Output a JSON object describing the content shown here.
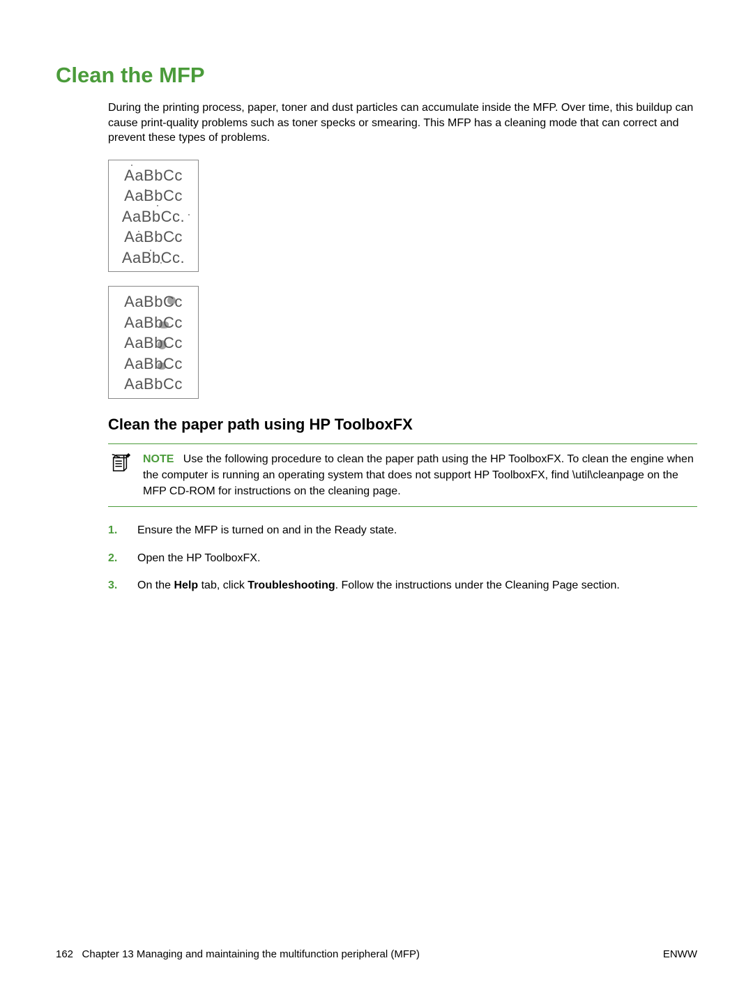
{
  "heading": "Clean the MFP",
  "intro": "During the printing process, paper, toner and dust particles can accumulate inside the MFP. Over time, this buildup can cause print-quality problems such as toner specks or smearing. This MFP has a cleaning mode that can correct and prevent these types of problems.",
  "sample_box_1": {
    "lines": [
      "AaBbCc",
      "AaBbCc",
      "AaBbCc.",
      "AaBbCc",
      "AaBbCc."
    ]
  },
  "sample_box_2": {
    "lines": [
      "AaBbCc",
      "AaBbCc",
      "AaBbCc",
      "AaBbCc",
      "AaBbCc"
    ]
  },
  "subheading": "Clean the paper path using HP ToolboxFX",
  "note": {
    "label": "NOTE",
    "text": "Use the following procedure to clean the paper path using the HP ToolboxFX. To clean the engine when the computer is running an operating system that does not support HP ToolboxFX, find \\util\\cleanpage on the MFP CD-ROM for instructions on the cleaning page."
  },
  "steps": [
    {
      "num": "1.",
      "text": "Ensure the MFP is turned on and in the Ready state."
    },
    {
      "num": "2.",
      "text": "Open the HP ToolboxFX."
    },
    {
      "num": "3.",
      "prefix": "On the ",
      "bold1": "Help",
      "mid": " tab, click ",
      "bold2": "Troubleshooting",
      "suffix": ". Follow the instructions under the Cleaning Page section."
    }
  ],
  "footer": {
    "page_num": "162",
    "chapter": "Chapter 13   Managing and maintaining the multifunction peripheral (MFP)",
    "right": "ENWW"
  }
}
